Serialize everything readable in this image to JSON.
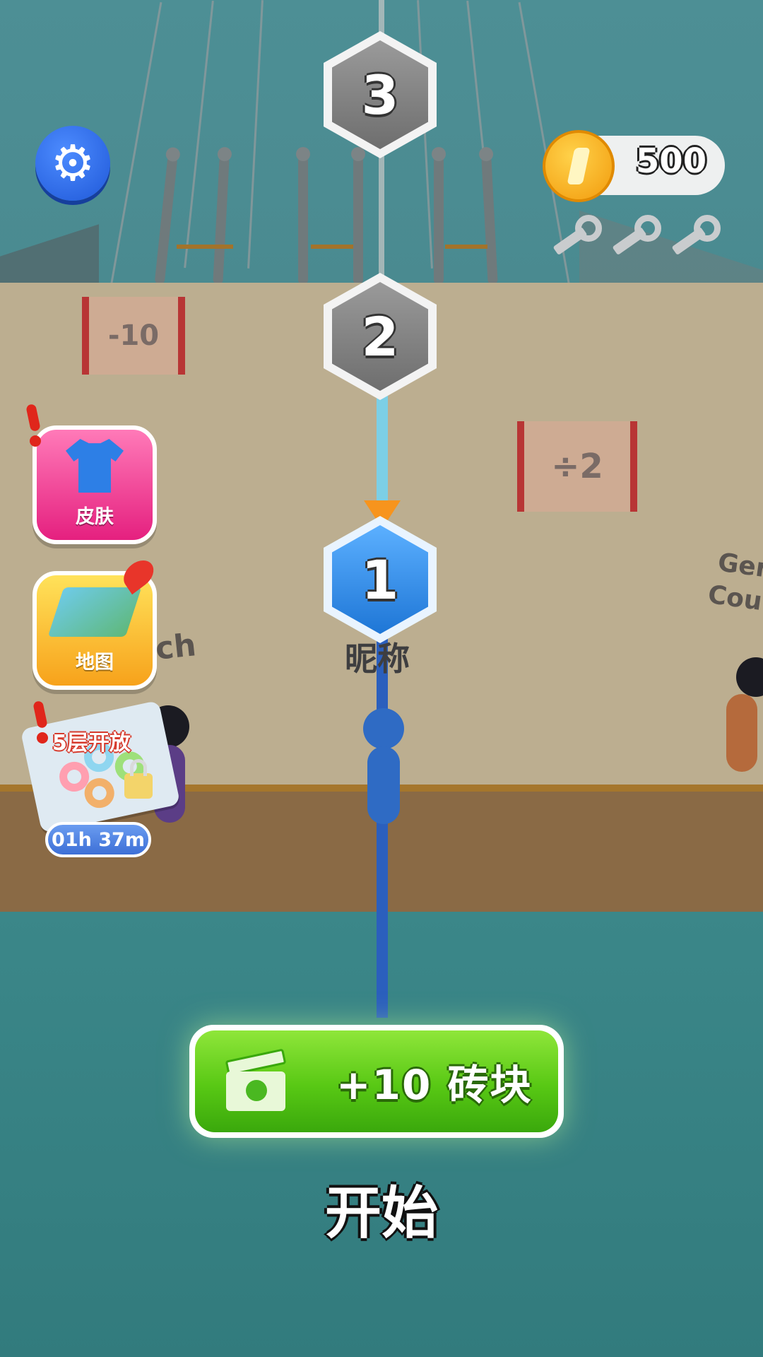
{
  "hud": {
    "settings_icon": "gear-icon",
    "coins": "500",
    "coin_icon": "coin-icon",
    "keys": [
      "key-icon",
      "key-icon",
      "key-icon"
    ]
  },
  "level_path": {
    "nodes": [
      {
        "label": "3",
        "state": "locked"
      },
      {
        "label": "2",
        "state": "locked"
      },
      {
        "label": "1",
        "state": "current"
      }
    ],
    "player_name": "昵称"
  },
  "scene": {
    "gates": [
      {
        "label": "-10"
      },
      {
        "label": "÷2"
      }
    ],
    "name_tags": [
      "ch",
      "Ger",
      "Cou"
    ]
  },
  "side_menu": {
    "skin": {
      "label": "皮肤",
      "icon": "shirt-icon",
      "alert": true
    },
    "map": {
      "label": "地图",
      "icon": "map-icon"
    },
    "next_level": {
      "label": "5层开放",
      "timer": "01h 37m",
      "icon": "lock-icon",
      "alert": true
    }
  },
  "actions": {
    "bricks_button": "+10 砖块",
    "bricks_icon": "video-ad-icon",
    "start": "开始"
  },
  "colors": {
    "accent_green": "#58c814",
    "accent_blue": "#1e76d6",
    "water": "#3d8a8f"
  }
}
